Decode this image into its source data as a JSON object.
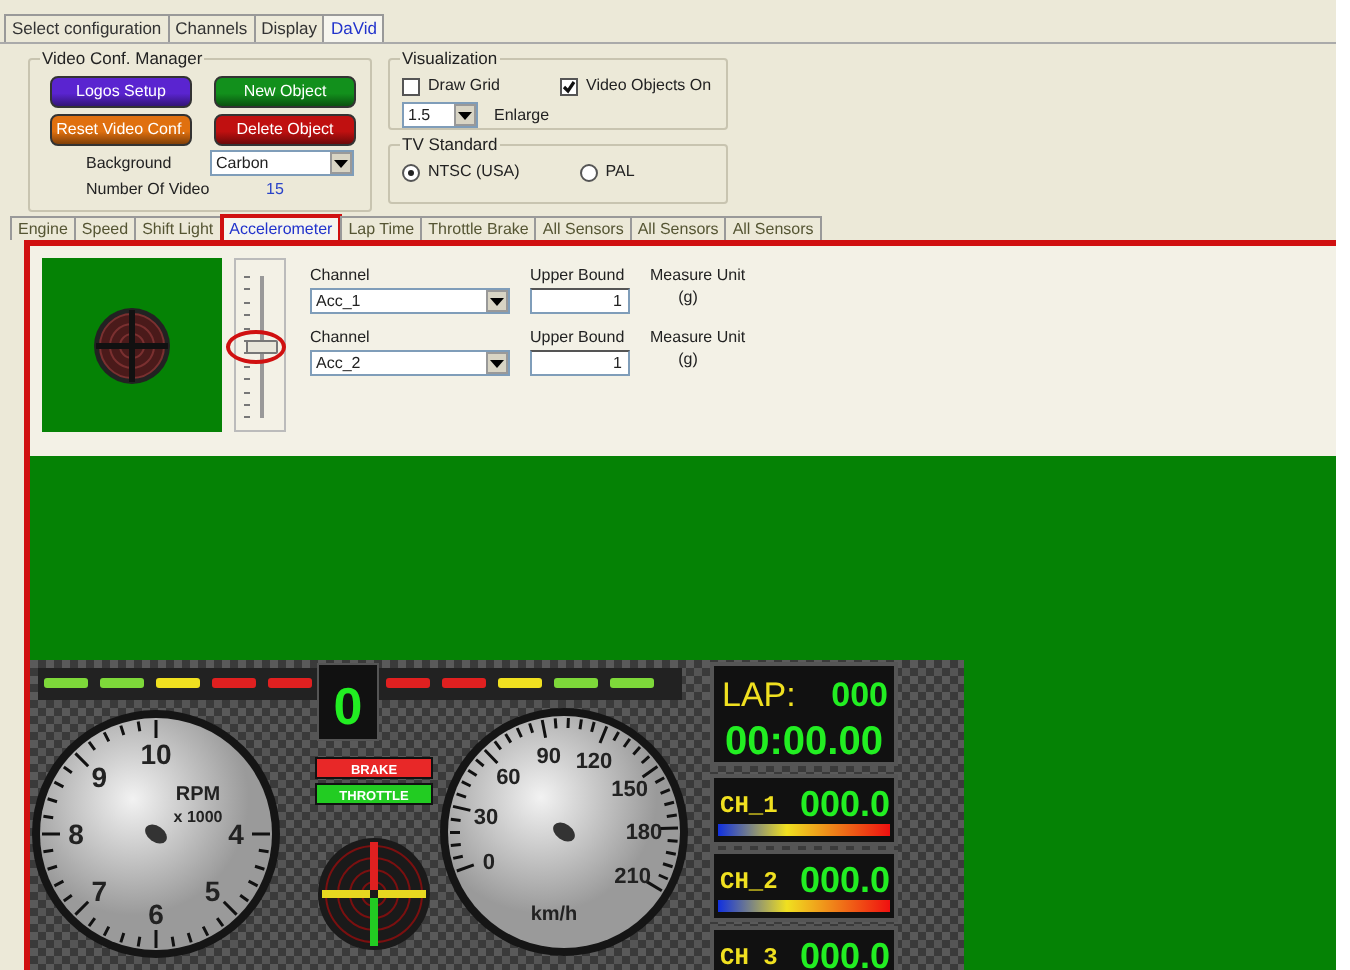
{
  "top_tabs": [
    {
      "label": "Select configuration",
      "selected": false
    },
    {
      "label": "Channels",
      "selected": false
    },
    {
      "label": "Display",
      "selected": false
    },
    {
      "label": "DaVid",
      "selected": true
    }
  ],
  "video_conf_manager": {
    "title": "Video Conf. Manager",
    "buttons": [
      {
        "label": "Logos Setup",
        "color": "#5a24d0"
      },
      {
        "label": "New Object",
        "color": "#12901c"
      },
      {
        "label": "Reset Video Conf.",
        "color": "#e0700f"
      },
      {
        "label": "Delete Object",
        "color": "#c01010"
      }
    ],
    "background_label": "Background",
    "background_value": "Carbon",
    "number_label": "Number Of Video",
    "number_value": "15"
  },
  "visualization": {
    "title": "Visualization",
    "options": [
      {
        "label": "Draw Grid",
        "checked": false
      },
      {
        "label": "Video Objects On",
        "checked": true
      }
    ],
    "zoom_value": "1.5",
    "zoom_label": "Enlarge"
  },
  "tv_standard": {
    "title": "TV Standard",
    "options": [
      {
        "label": "NTSC (USA)",
        "selected": true
      },
      {
        "label": "PAL",
        "selected": false
      }
    ]
  },
  "sensor_tabs": [
    {
      "label": "Engine",
      "selected": false,
      "highlighted": false
    },
    {
      "label": "Speed",
      "selected": false,
      "highlighted": false
    },
    {
      "label": "Shift Light",
      "selected": false,
      "highlighted": false
    },
    {
      "label": "Accelerometer",
      "selected": true,
      "highlighted": true
    },
    {
      "label": "Lap Time",
      "selected": false,
      "highlighted": false
    },
    {
      "label": "Throttle Brake",
      "selected": false,
      "highlighted": false
    },
    {
      "label": "All Sensors",
      "selected": false,
      "highlighted": false
    },
    {
      "label": "All Sensors",
      "selected": false,
      "highlighted": false
    },
    {
      "label": "All Sensors",
      "selected": false,
      "highlighted": false
    }
  ],
  "accelerometer": {
    "slider": {
      "level": 0.5,
      "highlighted": true
    },
    "channels": [
      {
        "channel_label": "Channel",
        "channel_value": "Acc_1",
        "bound_label": "Upper Bound",
        "bound_value": "1",
        "unit_label": "Measure Unit",
        "unit_value": "(g)"
      },
      {
        "channel_label": "Channel",
        "channel_value": "Acc_2",
        "bound_label": "Upper Bound",
        "bound_value": "1",
        "unit_label": "Measure Unit",
        "unit_value": "(g)"
      }
    ]
  },
  "dashboard": {
    "shift_lights": [
      {
        "color": "#7ed83a"
      },
      {
        "color": "#7ed83a"
      },
      {
        "color": "#f0e020"
      },
      {
        "color": "#e02020"
      },
      {
        "color": "#e02020"
      },
      {
        "color": "#e02020"
      },
      {
        "color": "#e02020"
      },
      {
        "color": "#f0e020"
      },
      {
        "color": "#7ed83a"
      },
      {
        "color": "#7ed83a"
      }
    ],
    "gear": "0",
    "rpm_gauge": {
      "labels": [
        "4",
        "5",
        "6",
        "7",
        "8",
        "9",
        "10"
      ],
      "unit": "RPM",
      "multiplier": "x 1000"
    },
    "brake_label": "BRAKE",
    "throttle_label": "THROTTLE",
    "speed_gauge": {
      "labels": [
        "0",
        "30",
        "60",
        "90",
        "120",
        "150",
        "180",
        "210"
      ],
      "unit": "km/h"
    },
    "lap": {
      "label": "LAP:",
      "count": "000",
      "time": "00:00.00"
    },
    "channels": [
      {
        "name": "CH_1",
        "value": "000.0"
      },
      {
        "name": "CH_2",
        "value": "000.0"
      },
      {
        "name": "CH 3",
        "value": "000.0"
      }
    ]
  }
}
